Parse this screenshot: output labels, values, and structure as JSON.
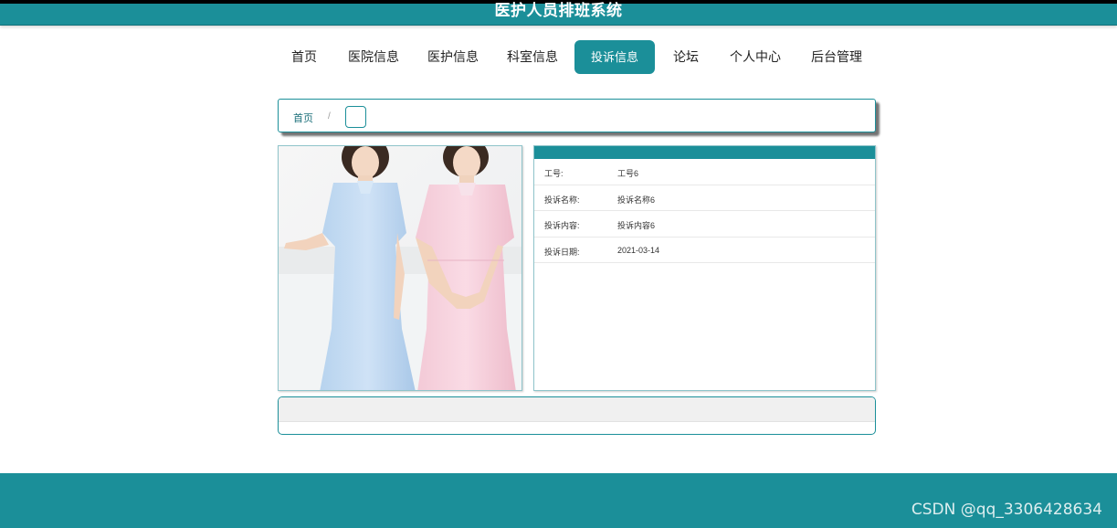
{
  "header": {
    "title": "医护人员排班系统"
  },
  "nav": {
    "items": [
      "首页",
      "医院信息",
      "医护信息",
      "科室信息",
      "投诉信息",
      "论坛",
      "个人中心",
      "后台管理"
    ],
    "active_index": 4
  },
  "breadcrumb": {
    "home": "首页",
    "separator": "/"
  },
  "details": {
    "rows": [
      {
        "key": "工号:",
        "value": "工号6"
      },
      {
        "key": "投诉名称:",
        "value": "投诉名称6"
      },
      {
        "key": "投诉内容:",
        "value": "投诉内容6"
      },
      {
        "key": "投诉日期:",
        "value": "2021-03-14"
      }
    ]
  },
  "watermark": "CSDN @qq_3306428634",
  "colors": {
    "primary": "#1b8f99"
  }
}
